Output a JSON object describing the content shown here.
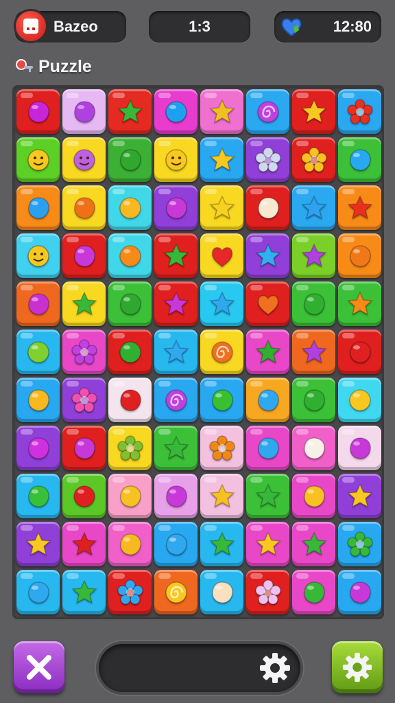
{
  "header": {
    "player_name": "Bazeo",
    "score": "1:3",
    "time": "12:80",
    "subtitle": "Puzzle"
  },
  "icons": {
    "avatar": "red-avatar-icon",
    "time": "blue-heart-icon",
    "subtitle": "key-icon",
    "close": "close-x-icon",
    "gear": "gear-icon"
  },
  "board": {
    "rows": 11,
    "cols": 8,
    "tiles": [
      {
        "bg": "#e0201e",
        "shape": "blob",
        "color": "#c824d8"
      },
      {
        "bg": "#e6b8f4",
        "shape": "blob",
        "color": "#b040e0"
      },
      {
        "bg": "#e52a22",
        "shape": "star",
        "color": "#38b838"
      },
      {
        "bg": "#e83ccf",
        "shape": "circle",
        "color": "#1ea0f0"
      },
      {
        "bg": "#f070d0",
        "shape": "star",
        "color": "#f0c020"
      },
      {
        "bg": "#2aa8f0",
        "shape": "swirl",
        "color": "#c040e0"
      },
      {
        "bg": "#e0201e",
        "shape": "star",
        "color": "#f8c820"
      },
      {
        "bg": "#2aa8f0",
        "shape": "flower",
        "color": "#e83020"
      },
      {
        "bg": "#5cd024",
        "shape": "smiley",
        "color": "#f8c820"
      },
      {
        "bg": "#f8d820",
        "shape": "smiley",
        "color": "#c060e0"
      },
      {
        "bg": "#3cb034",
        "shape": "blob",
        "color": "#30a830"
      },
      {
        "bg": "#f8d820",
        "shape": "smiley",
        "color": "#f8c820"
      },
      {
        "bg": "#28a8f0",
        "shape": "star",
        "color": "#f8c820"
      },
      {
        "bg": "#9040d8",
        "shape": "flower",
        "color": "#d0d8f0"
      },
      {
        "bg": "#e0201e",
        "shape": "flower",
        "color": "#f8c020"
      },
      {
        "bg": "#3cc038",
        "shape": "blob",
        "color": "#28a8f0"
      },
      {
        "bg": "#f88a18",
        "shape": "blob",
        "color": "#2aa0f0"
      },
      {
        "bg": "#f8d820",
        "shape": "blob",
        "color": "#f07018"
      },
      {
        "bg": "#40d8e8",
        "shape": "circle",
        "color": "#f8b820"
      },
      {
        "bg": "#9040d8",
        "shape": "blob",
        "color": "#c838d8"
      },
      {
        "bg": "#f8d820",
        "shape": "star",
        "color": "#f8d020"
      },
      {
        "bg": "#e0201e",
        "shape": "blob",
        "color": "#f8e8d0"
      },
      {
        "bg": "#2aa8f0",
        "shape": "star",
        "color": "#30a0f0"
      },
      {
        "bg": "#f88a18",
        "shape": "star",
        "color": "#e83020"
      },
      {
        "bg": "#40d0f0",
        "shape": "smiley",
        "color": "#f8c820"
      },
      {
        "bg": "#e0201e",
        "shape": "blob",
        "color": "#c838d8"
      },
      {
        "bg": "#40d8e8",
        "shape": "circle",
        "color": "#f88a18"
      },
      {
        "bg": "#e0201e",
        "shape": "star",
        "color": "#38b838"
      },
      {
        "bg": "#f8d820",
        "shape": "heart",
        "color": "#e82828"
      },
      {
        "bg": "#9040d8",
        "shape": "star",
        "color": "#30b0f0"
      },
      {
        "bg": "#7ad028",
        "shape": "star",
        "color": "#b040e0"
      },
      {
        "bg": "#f88a18",
        "shape": "blob",
        "color": "#f07818"
      },
      {
        "bg": "#f06820",
        "shape": "blob",
        "color": "#c830d0"
      },
      {
        "bg": "#f8d820",
        "shape": "star",
        "color": "#38b838"
      },
      {
        "bg": "#3cc038",
        "shape": "blob",
        "color": "#30a830"
      },
      {
        "bg": "#e0201e",
        "shape": "star",
        "color": "#c838d8"
      },
      {
        "bg": "#28c8f0",
        "shape": "star",
        "color": "#30a8f0"
      },
      {
        "bg": "#e0201e",
        "shape": "heart",
        "color": "#f07020"
      },
      {
        "bg": "#3cc038",
        "shape": "blob",
        "color": "#30b030"
      },
      {
        "bg": "#3cc038",
        "shape": "star",
        "color": "#f88a18"
      },
      {
        "bg": "#28b8f0",
        "shape": "circle",
        "color": "#80d030"
      },
      {
        "bg": "#e848c8",
        "shape": "flower",
        "color": "#c040e0"
      },
      {
        "bg": "#e0201e",
        "shape": "circle",
        "color": "#30b030"
      },
      {
        "bg": "#28b8f0",
        "shape": "star",
        "color": "#30a8f0"
      },
      {
        "bg": "#f8d820",
        "shape": "swirl",
        "color": "#f07020"
      },
      {
        "bg": "#e848c8",
        "shape": "star",
        "color": "#30b030"
      },
      {
        "bg": "#f06820",
        "shape": "star",
        "color": "#b040e0"
      },
      {
        "bg": "#e0201e",
        "shape": "blob",
        "color": "#e02020"
      },
      {
        "bg": "#28a8f0",
        "shape": "blob",
        "color": "#f8b820"
      },
      {
        "bg": "#9040d8",
        "shape": "flower",
        "color": "#f050b0"
      },
      {
        "bg": "#f4e4ee",
        "shape": "blob",
        "color": "#e02020"
      },
      {
        "bg": "#28a8f0",
        "shape": "swirl",
        "color": "#c040e0"
      },
      {
        "bg": "#28a8f0",
        "shape": "blob",
        "color": "#38c030"
      },
      {
        "bg": "#f8a820",
        "shape": "blob",
        "color": "#30a8f0"
      },
      {
        "bg": "#3cc038",
        "shape": "blob",
        "color": "#30b030"
      },
      {
        "bg": "#40d8f0",
        "shape": "circle",
        "color": "#f8c820"
      },
      {
        "bg": "#9040d8",
        "shape": "blob",
        "color": "#d030e0"
      },
      {
        "bg": "#e0201e",
        "shape": "blob",
        "color": "#c838d8"
      },
      {
        "bg": "#f8d820",
        "shape": "flower",
        "color": "#80c030"
      },
      {
        "bg": "#3cc038",
        "shape": "star",
        "color": "#38b838"
      },
      {
        "bg": "#f4c0e0",
        "shape": "flower",
        "color": "#f08818"
      },
      {
        "bg": "#e848c8",
        "shape": "blob",
        "color": "#30a8f0"
      },
      {
        "bg": "#f060c8",
        "shape": "blob",
        "color": "#f8f0e8"
      },
      {
        "bg": "#f4d8ec",
        "shape": "blob",
        "color": "#c838d8"
      },
      {
        "bg": "#28b8f0",
        "shape": "blob",
        "color": "#38c038"
      },
      {
        "bg": "#5cc828",
        "shape": "circle",
        "color": "#e02020"
      },
      {
        "bg": "#f8a0c8",
        "shape": "blob",
        "color": "#f8c020"
      },
      {
        "bg": "#e8a0e8",
        "shape": "blob",
        "color": "#c838d8"
      },
      {
        "bg": "#f4c0e0",
        "shape": "star",
        "color": "#f8c020"
      },
      {
        "bg": "#3cc038",
        "shape": "star",
        "color": "#38b838"
      },
      {
        "bg": "#e848c8",
        "shape": "blob",
        "color": "#f8c020"
      },
      {
        "bg": "#9040d8",
        "shape": "star",
        "color": "#f8c820"
      },
      {
        "bg": "#9040d8",
        "shape": "star",
        "color": "#f8c820"
      },
      {
        "bg": "#e848c8",
        "shape": "star",
        "color": "#e02020"
      },
      {
        "bg": "#f060c8",
        "shape": "blob",
        "color": "#f8b820"
      },
      {
        "bg": "#28a8f0",
        "shape": "blob",
        "color": "#30a8f0"
      },
      {
        "bg": "#28b8f0",
        "shape": "star",
        "color": "#38b838"
      },
      {
        "bg": "#e848c8",
        "shape": "star",
        "color": "#f8c820"
      },
      {
        "bg": "#e848c8",
        "shape": "star",
        "color": "#38b838"
      },
      {
        "bg": "#28a8f0",
        "shape": "flower",
        "color": "#38b838"
      },
      {
        "bg": "#28b8f0",
        "shape": "blob",
        "color": "#30a8f0"
      },
      {
        "bg": "#28b8f0",
        "shape": "star",
        "color": "#38b838"
      },
      {
        "bg": "#e0201e",
        "shape": "flower",
        "color": "#30a8f0"
      },
      {
        "bg": "#f06820",
        "shape": "swirl",
        "color": "#f8c820"
      },
      {
        "bg": "#28b8f0",
        "shape": "blob",
        "color": "#f8e0c0"
      },
      {
        "bg": "#e0201e",
        "shape": "flower",
        "color": "#f0c0f0"
      },
      {
        "bg": "#e848c8",
        "shape": "blob",
        "color": "#38b838"
      },
      {
        "bg": "#28a8f0",
        "shape": "blob",
        "color": "#c838d8"
      }
    ]
  },
  "footer": {
    "close_icon": "close-x-icon",
    "settings_icon": "gear-icon"
  }
}
